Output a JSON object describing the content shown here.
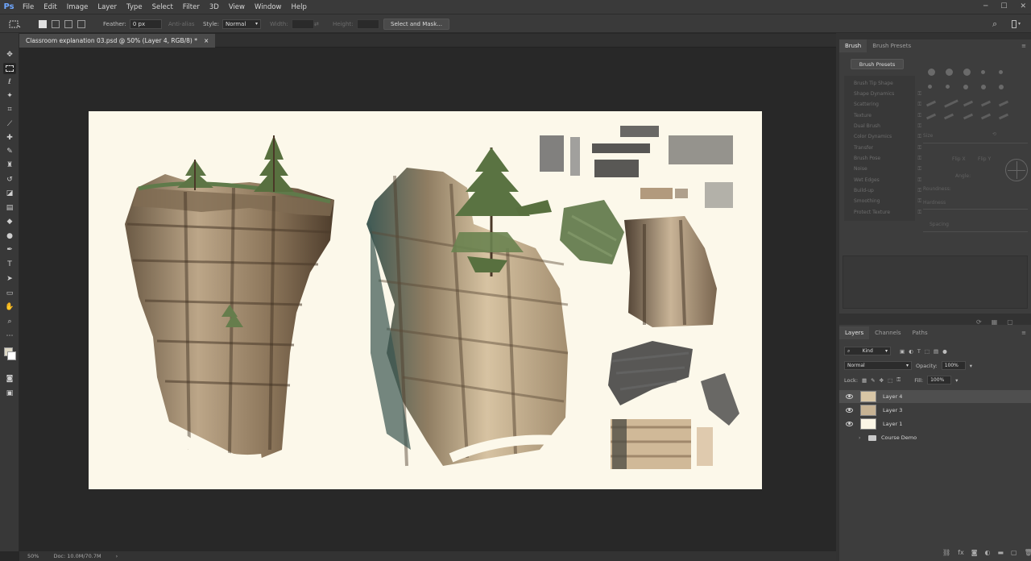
{
  "app": {
    "logo": "Ps"
  },
  "menu": [
    "File",
    "Edit",
    "Image",
    "Layer",
    "Type",
    "Select",
    "Filter",
    "3D",
    "View",
    "Window",
    "Help"
  ],
  "options_bar": {
    "feather_label": "Feather:",
    "feather_value": "0 px",
    "anti_alias_label": "Anti-alias",
    "style_label": "Style:",
    "style_value": "Normal",
    "width_label": "Width:",
    "height_label": "Height:",
    "select_mask_label": "Select and Mask..."
  },
  "document": {
    "tab_title": "Classroom explanation 03.psd @ 50% (Layer 4, RGB/8) *",
    "close_glyph": "×"
  },
  "status": {
    "zoom": "50%",
    "doc_info": "Doc: 10.0M/70.7M",
    "arrow": "›"
  },
  "brush_panel": {
    "tabs": [
      "Brush",
      "Brush Presets"
    ],
    "presets_button": "Brush Presets",
    "options": [
      "Brush Tip Shape",
      "Shape Dynamics",
      "Scattering",
      "Texture",
      "Dual Brush",
      "Color Dynamics",
      "Transfer",
      "Brush Pose",
      "Noise",
      "Wet Edges",
      "Build-up",
      "Smoothing",
      "Protect Texture"
    ],
    "size_label": "Size",
    "flip_x": "Flip X",
    "flip_y": "Flip Y",
    "angle_label": "Angle:",
    "roundness_label": "Roundness:",
    "hardness_label": "Hardness",
    "spacing_label": "Spacing"
  },
  "layers_panel": {
    "tabs": [
      "Layers",
      "Channels",
      "Paths"
    ],
    "kind_label": "Kind",
    "blend_mode": "Normal",
    "opacity_label": "Opacity:",
    "opacity_value": "100%",
    "lock_label": "Lock:",
    "fill_label": "Fill:",
    "fill_value": "100%",
    "layers": [
      {
        "name": "Layer 4",
        "visible": true,
        "selected": true
      },
      {
        "name": "Layer 3",
        "visible": true,
        "selected": false
      },
      {
        "name": "Layer 1",
        "visible": true,
        "selected": false
      },
      {
        "name": "Course Demo",
        "visible": false,
        "selected": false,
        "group": true
      }
    ]
  },
  "colors": {
    "accent": "#6fa7ff",
    "canvas_bg": "#fcf8ea",
    "workspace": "#282828",
    "panel": "#3d3d3d",
    "rock_light": "#c7b294",
    "rock_dark": "#5d4a36",
    "pine": "#556b45"
  }
}
